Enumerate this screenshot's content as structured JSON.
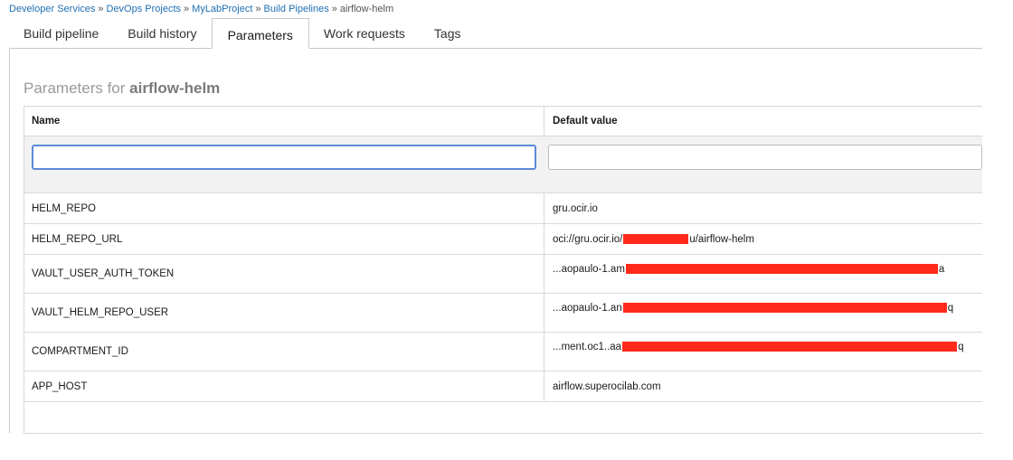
{
  "breadcrumb": {
    "items": [
      "Developer Services",
      "DevOps Projects",
      "MyLabProject",
      "Build Pipelines"
    ],
    "current": "airflow-helm",
    "separator": "»"
  },
  "tabs": [
    {
      "label": "Build pipeline",
      "active": false
    },
    {
      "label": "Build history",
      "active": false
    },
    {
      "label": "Parameters",
      "active": true
    },
    {
      "label": "Work requests",
      "active": false
    },
    {
      "label": "Tags",
      "active": false
    }
  ],
  "section": {
    "title_prefix": "Parameters for",
    "title_name": "airflow-helm"
  },
  "table": {
    "headers": {
      "name": "Name",
      "value": "Default value"
    },
    "filter": {
      "name_value": "",
      "value_value": ""
    },
    "rows": [
      {
        "name": "HELM_REPO",
        "value_prefix": "gru.ocir.io",
        "value_suffix": "",
        "redacted": false
      },
      {
        "name": "HELM_REPO_URL",
        "value_prefix": "oci://gru.ocir.io/",
        "value_suffix": "u/airflow-helm",
        "redacted": true
      },
      {
        "name": "VAULT_USER_AUTH_TOKEN",
        "value_prefix": "...aopaulo-1.am",
        "value_suffix": "a",
        "redacted": true
      },
      {
        "name": "VAULT_HELM_REPO_USER",
        "value_prefix": "...aopaulo-1.an",
        "value_suffix": "q",
        "redacted": true
      },
      {
        "name": "COMPARTMENT_ID",
        "value_prefix": "...ment.oc1..aa",
        "value_suffix": "q",
        "redacted": true
      },
      {
        "name": "APP_HOST",
        "value_prefix": "airflow.superocilab.com",
        "value_suffix": "",
        "redacted": false
      }
    ]
  },
  "colors": {
    "link": "#1f6fb2",
    "redaction": "#ff2a1c",
    "focus": "#5b8bd6"
  }
}
